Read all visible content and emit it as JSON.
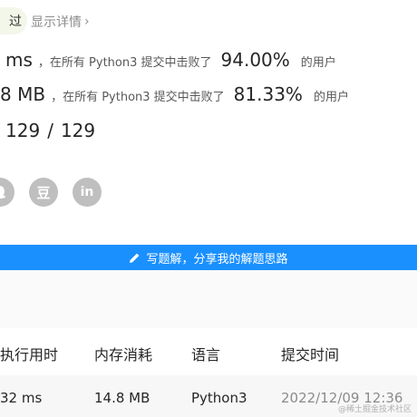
{
  "status": {
    "badge": "过",
    "details_link": "显示详情"
  },
  "runtime": {
    "value": "ms",
    "middle": "，在所有 Python3 提交中击败了",
    "percent": "94.00%",
    "suffix": "的用户"
  },
  "memory": {
    "value": "8 MB",
    "middle": "，在所有 Python3 提交中击败了",
    "percent": "81.33%",
    "suffix": "的用户"
  },
  "testcases": {
    "passed": "129",
    "separator": "/",
    "total": "129"
  },
  "share": {
    "icons": [
      "qq-icon",
      "douban-icon",
      "linkedin-icon"
    ],
    "douban_glyph": "豆",
    "linkedin_glyph": "in"
  },
  "solution_button": {
    "label": "写题解，分享我的解题思路"
  },
  "table": {
    "headers": [
      "执行用时",
      "内存消耗",
      "语言",
      "提交时间"
    ],
    "row": [
      "32 ms",
      "14.8 MB",
      "Python3",
      "2022/12/09 12:36"
    ]
  },
  "watermark": "@稀土掘金技术社区",
  "colors": {
    "accent": "#1a90ff",
    "icon_gray": "#bfbfbf",
    "badge_bg": "#f3f7ea"
  }
}
